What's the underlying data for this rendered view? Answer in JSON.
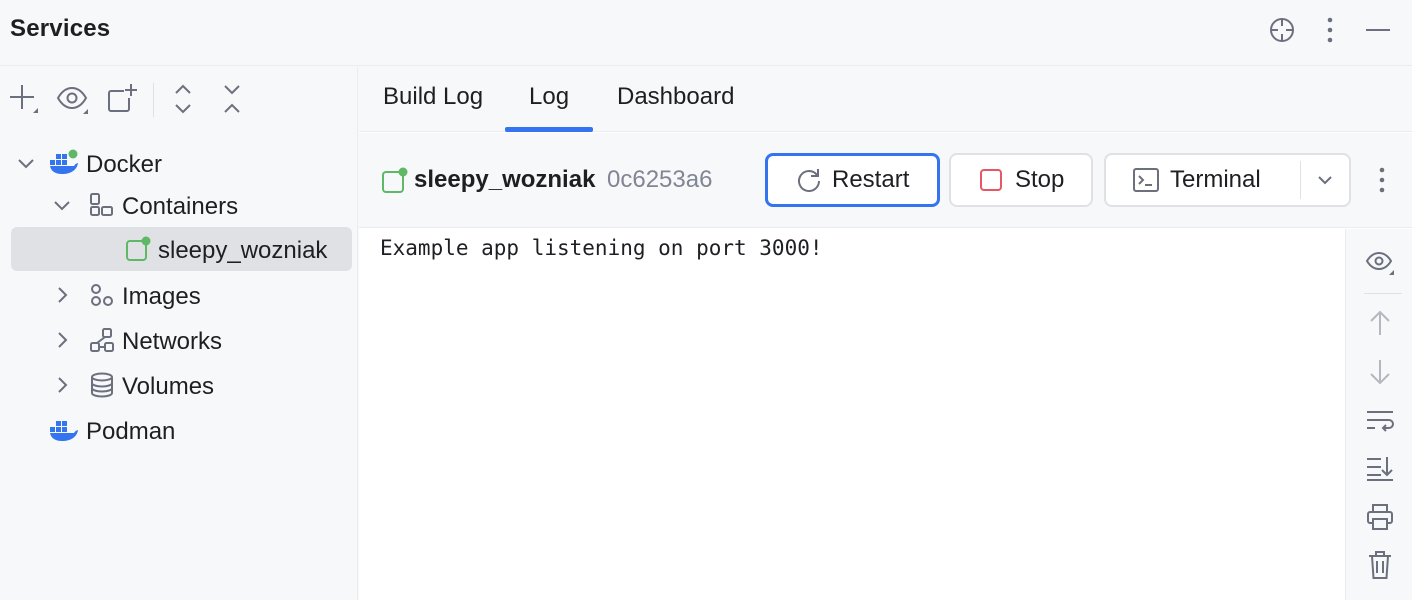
{
  "header": {
    "title": "Services",
    "icons": [
      "locate-icon",
      "more-vertical-icon",
      "minimize-icon"
    ]
  },
  "toolbar": {
    "buttons": [
      "add-icon",
      "view-options-icon",
      "new-container-icon",
      "expand-all-icon",
      "collapse-all-icon"
    ]
  },
  "tree": {
    "items": [
      {
        "label": "Docker",
        "icon": "docker-icon",
        "expanded": true
      },
      {
        "label": "Containers",
        "icon": "containers-icon",
        "expanded": true
      },
      {
        "label": "sleepy_wozniak",
        "icon": "container-running-icon",
        "selected": true
      },
      {
        "label": "Images",
        "icon": "images-icon",
        "expanded": false
      },
      {
        "label": "Networks",
        "icon": "networks-icon",
        "expanded": false
      },
      {
        "label": "Volumes",
        "icon": "volumes-icon",
        "expanded": false
      },
      {
        "label": "Podman",
        "icon": "podman-icon"
      }
    ]
  },
  "tabs": [
    {
      "label": "Build Log",
      "active": false
    },
    {
      "label": "Log",
      "active": true
    },
    {
      "label": "Dashboard",
      "active": false
    }
  ],
  "container": {
    "name": "sleepy_wozniak",
    "id": "0c6253a6",
    "status_color": "#5fb865"
  },
  "actions": {
    "restart": "Restart",
    "stop": "Stop",
    "terminal": "Terminal"
  },
  "log": {
    "lines": [
      "Example app listening on port 3000!"
    ]
  },
  "gutter": {
    "icons": [
      "view-options-icon",
      "scroll-up-icon",
      "scroll-down-icon",
      "soft-wrap-icon",
      "scroll-to-end-icon",
      "print-icon",
      "clear-log-icon"
    ]
  },
  "colors": {
    "accent": "#3574f0",
    "docker_blue": "#3574f0",
    "running_green": "#5fb865",
    "stop_red": "#e55765",
    "selection": "#dfe1e5"
  }
}
